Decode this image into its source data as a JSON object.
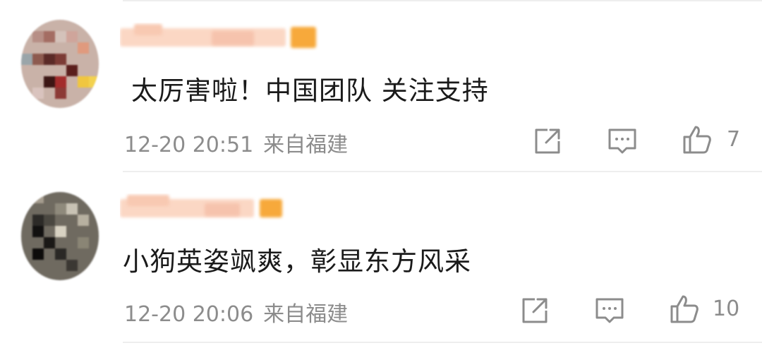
{
  "comments": [
    {
      "username": "",
      "text": "太厉害啦！中国团队 关注支持",
      "time": "12-20 20:51",
      "location": "来自福建",
      "likes": "7"
    },
    {
      "username": "",
      "text": "小狗英姿飒爽，彰显东方风采",
      "time": "12-20 20:06",
      "location": "来自福建",
      "likes": "10"
    }
  ],
  "icons": {
    "share": "share-icon",
    "comment": "comment-icon",
    "like": "thumbs-up-icon"
  },
  "colors": {
    "text": "#1a1a1a",
    "meta": "#8c8c8c",
    "icon": "#8c8c8c",
    "divider": "#eeeeee",
    "username_blur": "#fbd7c4",
    "username_badge": "#f7a93b"
  }
}
